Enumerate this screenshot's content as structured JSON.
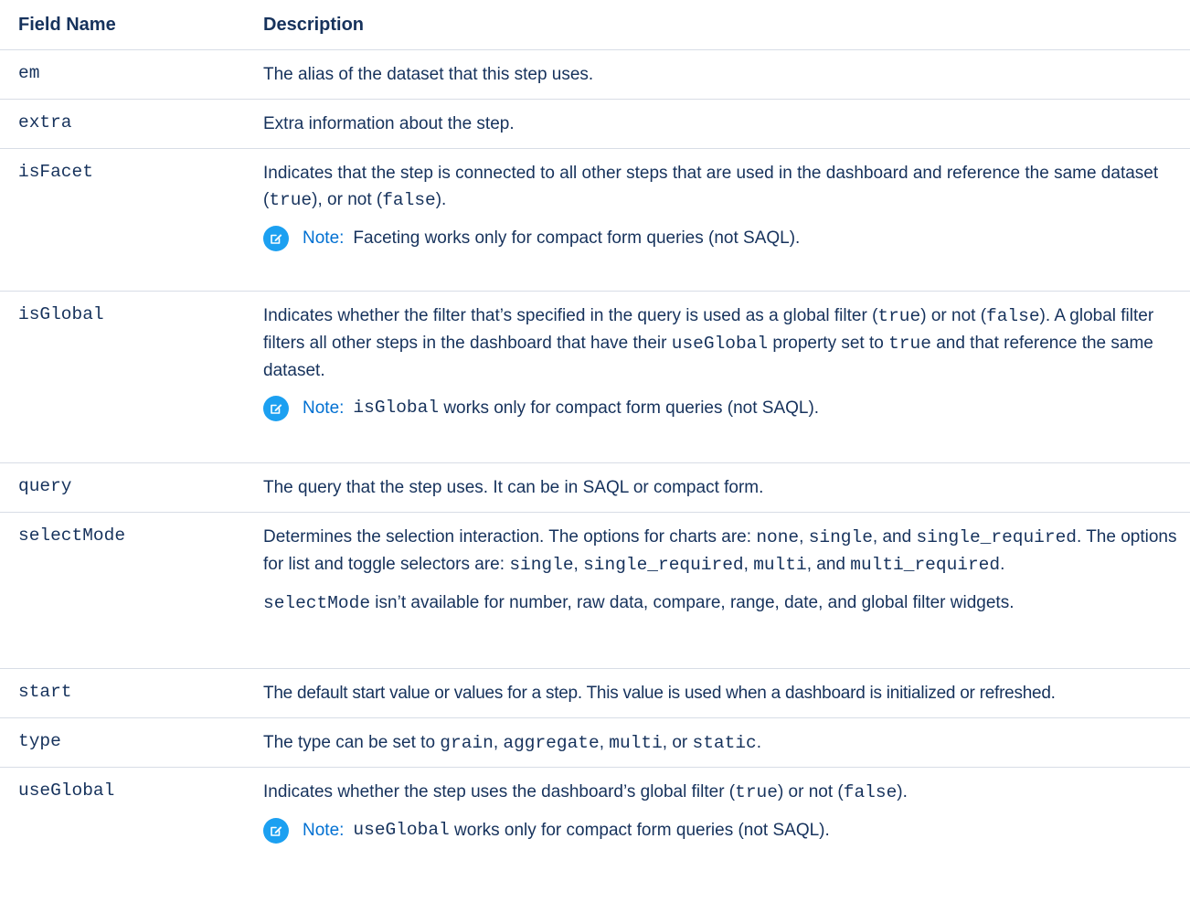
{
  "table": {
    "col_field": "Field Name",
    "col_desc": "Description"
  },
  "rows": {
    "em": {
      "name": "em",
      "desc": "The alias of the dataset that this step uses."
    },
    "extra": {
      "name": "extra",
      "desc": "Extra information about the step."
    },
    "isFacet": {
      "name": "isFacet",
      "d1": "Indicates that the step is connected to all other steps that are used in the dashboard and reference the same dataset (",
      "c1": "true",
      "d2": "), or not (",
      "c2": "false",
      "d3": ").",
      "note_label": "Note:",
      "note_text": "Faceting works only for compact form queries (not SAQL)."
    },
    "isGlobal": {
      "name": "isGlobal",
      "d1": "Indicates whether the filter that’s specified in the query is used as a global filter (",
      "c1": "true",
      "d2": ") or not (",
      "c2": "false",
      "d3": "). A global filter filters all other steps in the dashboard that have their ",
      "c3": "useGlobal",
      "d4": " property set to ",
      "c4": "true",
      "d5": " and that reference the same dataset.",
      "note_label": "Note:",
      "note_code": "isGlobal",
      "note_text": " works only for compact form queries (not SAQL)."
    },
    "query": {
      "name": "query",
      "desc": "The query that the step uses. It can be in SAQL or compact form."
    },
    "selectMode": {
      "name": "selectMode",
      "d1": "Determines the selection interaction. The options for charts are: ",
      "c1": "none",
      "d2": ", ",
      "c2": "single",
      "d3": ", and ",
      "c3": "single_required",
      "d4": ". The options for list and toggle selectors are: ",
      "c4": "single",
      "d5": ", ",
      "c5": "single_required",
      "d6": ", ",
      "c6": "multi",
      "d7": ", and ",
      "c7": "multi_required",
      "d8": ".",
      "p2_code": "selectMode",
      "p2_text": " isn’t available for number, raw data, compare, range, date, and global filter widgets."
    },
    "start": {
      "name": "start",
      "desc": "The default start value or values for a step. This value is used when a dashboard is initialized or refreshed."
    },
    "type": {
      "name": "type",
      "d1": "The type can be set to ",
      "c1": "grain",
      "d2": ", ",
      "c2": "aggregate",
      "d3": ", ",
      "c3": "multi",
      "d4": ", or ",
      "c4": "static",
      "d5": "."
    },
    "useGlobal": {
      "name": "useGlobal",
      "d1": "Indicates whether the step uses the dashboard’s global filter (",
      "c1": "true",
      "d2": ") or not (",
      "c2": "false",
      "d3": ").",
      "note_label": "Note:",
      "note_code": "useGlobal",
      "note_text": " works only for compact form queries (not SAQL)."
    }
  },
  "colors": {
    "text": "#16325c",
    "note_label": "#0070d2",
    "note_icon": "#1ca0f1",
    "rule": "#d8dde6"
  },
  "icons": {
    "note": "edit-note-icon"
  }
}
